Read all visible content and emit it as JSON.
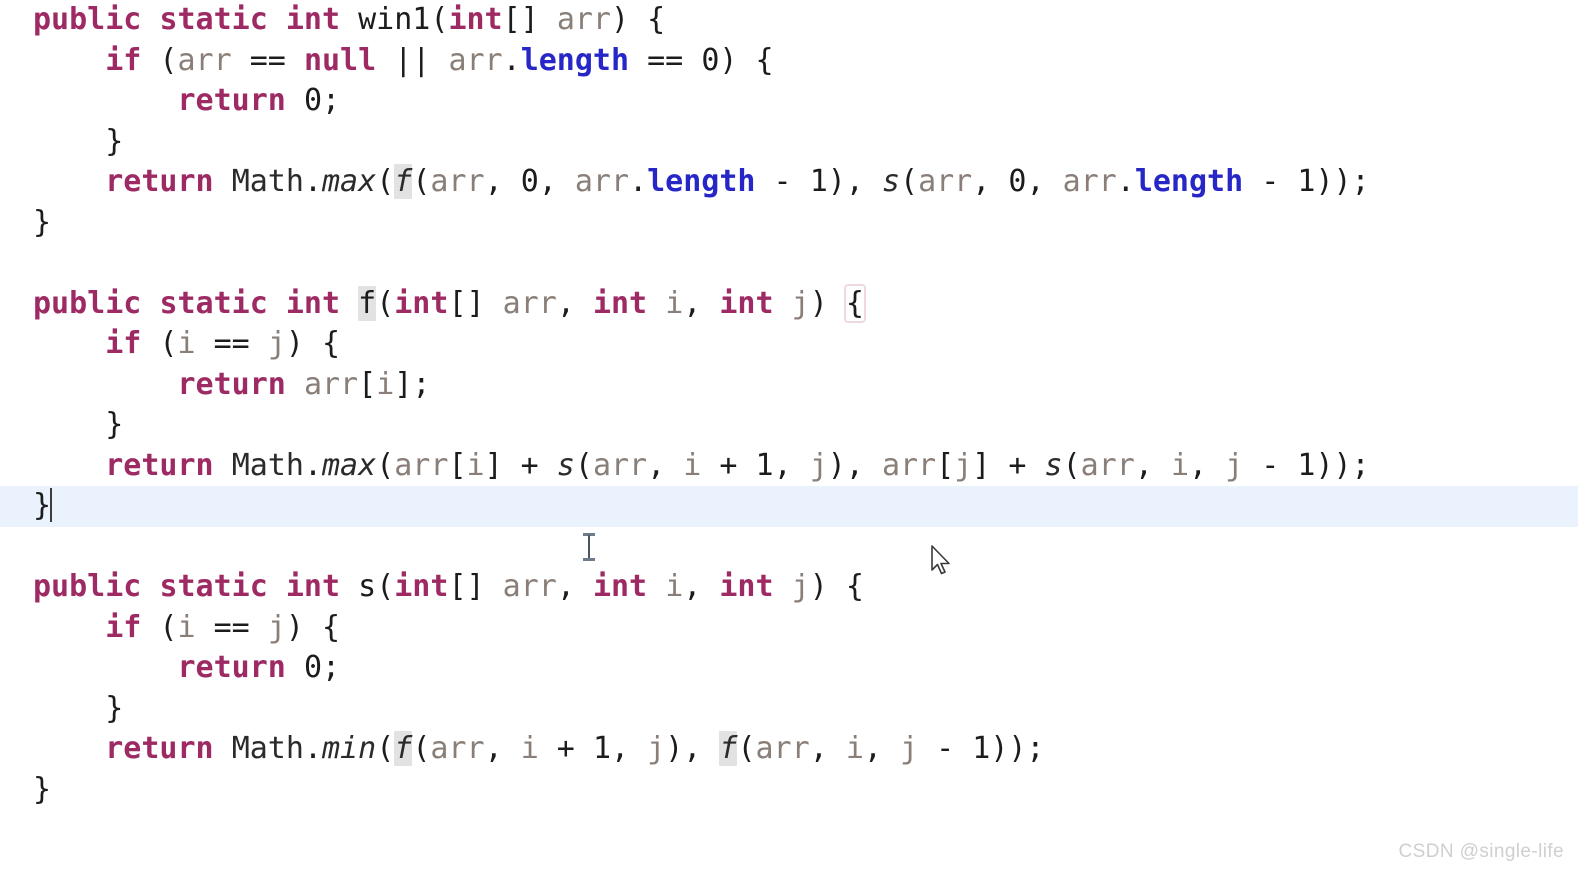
{
  "editor": {
    "language": "java",
    "background_color": "#ffffff",
    "current_line_highlight_color": "#e9f2fd",
    "symbol_occurrence_highlight_color": "#e2e2e2",
    "keyword_color": "#9e2a64",
    "field_color": "#2727c8",
    "parameter_color": "#8a7f78",
    "default_text_color": "#2b2b2b",
    "caret_color": "#3c3c3c"
  },
  "code": {
    "line01": {
      "kw_public": "public",
      "sp1": " ",
      "kw_static": "static",
      "sp2": " ",
      "kw_int": "int",
      "sp3": " ",
      "name": "win1",
      "paren_open": "(",
      "kw_int2": "int",
      "brackets": "[] ",
      "param": "arr",
      "paren_close": ")",
      "brace": " {"
    },
    "line02": {
      "indent": "    ",
      "kw_if": "if",
      "sp": " (",
      "param1": "arr",
      "op_eq": " == ",
      "kw_null": "null",
      "op_or": " || ",
      "param2": "arr",
      "dot": ".",
      "field": "length",
      "op_eq2": " == ",
      "num": "0",
      "tail": ") {"
    },
    "line03": {
      "indent": "        ",
      "kw_return": "return",
      "sp": " ",
      "num": "0",
      "semi": ";"
    },
    "line04": {
      "text": "    }"
    },
    "line05": {
      "indent": "    ",
      "kw_return": "return",
      "sp": " ",
      "cls": "Math",
      "dot": ".",
      "meth": "max",
      "p1": "(",
      "fcall": "f",
      "p2": "(",
      "a1": "arr",
      "c1": ", ",
      "n0": "0",
      "c2": ", ",
      "a2": "arr",
      "d2": ".",
      "len": "length",
      "minus1": " - ",
      "one": "1",
      "p3": "), ",
      "scall": "s",
      "p4": "(",
      "a3": "arr",
      "c3": ", ",
      "n0b": "0",
      "c4": ", ",
      "a4": "arr",
      "d3": ".",
      "len2": "length",
      "minus2": " - ",
      "one2": "1",
      "tail": "));"
    },
    "line06": {
      "text": "}"
    },
    "line07": {
      "text": ""
    },
    "line08": {
      "kw_public": "public",
      "sp1": " ",
      "kw_static": "static",
      "sp2": " ",
      "kw_int": "int",
      "sp3": " ",
      "name": "f",
      "paren_open": "(",
      "kw_int2": "int",
      "brackets": "[] ",
      "param": "arr",
      "comma1": ", ",
      "kw_int3": "int",
      "sp4": " ",
      "param2": "i",
      "comma2": ", ",
      "kw_int4": "int",
      "sp5": " ",
      "param3": "j",
      "paren_close": ") ",
      "brace": "{"
    },
    "line09": {
      "indent": "    ",
      "kw_if": "if",
      "sp": " (",
      "i": "i",
      "op": " == ",
      "j": "j",
      "tail": ") {"
    },
    "line10": {
      "indent": "        ",
      "kw_return": "return",
      "sp": " ",
      "expr": "arr",
      "br": "[",
      "i": "i",
      "br2": "]",
      "semi": ";"
    },
    "line11": {
      "text": "    }"
    },
    "line12": {
      "indent": "    ",
      "kw_return": "return",
      "sp": " ",
      "cls": "Math",
      "dot": ".",
      "meth": "max",
      "p1": "(",
      "a1": "arr",
      "b1": "[",
      "i1": "i",
      "b2": "]",
      "plus": " + ",
      "scall": "s",
      "p2": "(",
      "a2": "arr",
      "c1": ", ",
      "i2": "i",
      "plus2": " + ",
      "one": "1",
      "c2": ", ",
      "j1": "j",
      "p3": "), ",
      "a3": "arr",
      "b3": "[",
      "j2": "j",
      "b4": "]",
      "plus3": " + ",
      "scall2": "s",
      "p4": "(",
      "a4": "arr",
      "c3": ", ",
      "i3": "i",
      "c4": ", ",
      "j3": "j",
      "minus": " - ",
      "one2": "1",
      "tail": "));"
    },
    "line13": {
      "text": "}"
    },
    "line14": {
      "text": ""
    },
    "line15": {
      "kw_public": "public",
      "sp1": " ",
      "kw_static": "static",
      "sp2": " ",
      "kw_int": "int",
      "sp3": " ",
      "name": "s",
      "paren_open": "(",
      "kw_int2": "int",
      "brackets": "[] ",
      "param": "arr",
      "comma1": ", ",
      "kw_int3": "int",
      "sp4": " ",
      "param2": "i",
      "comma2": ", ",
      "kw_int4": "int",
      "sp5": " ",
      "param3": "j",
      "paren_close": ") ",
      "brace": "{"
    },
    "line16": {
      "indent": "    ",
      "kw_if": "if",
      "sp": " (",
      "i": "i",
      "op": " == ",
      "j": "j",
      "tail": ") {"
    },
    "line17": {
      "indent": "        ",
      "kw_return": "return",
      "sp": " ",
      "num": "0",
      "semi": ";"
    },
    "line18": {
      "text": "    }"
    },
    "line19": {
      "indent": "    ",
      "kw_return": "return",
      "sp": " ",
      "cls": "Math",
      "dot": ".",
      "meth": "min",
      "p1": "(",
      "fcall": "f",
      "p2": "(",
      "a1": "arr",
      "c1": ", ",
      "i1": "i",
      "plus": " + ",
      "one": "1",
      "c2": ", ",
      "j1": "j",
      "p3": "), ",
      "fcall2": "f",
      "p4": "(",
      "a2": "arr",
      "c3": ", ",
      "i2": "i",
      "c4": ", ",
      "j2": "j",
      "minus": " - ",
      "one2": "1",
      "tail": "));"
    },
    "line20": {
      "text": "}"
    }
  },
  "watermark": {
    "text": "CSDN @single-life"
  }
}
